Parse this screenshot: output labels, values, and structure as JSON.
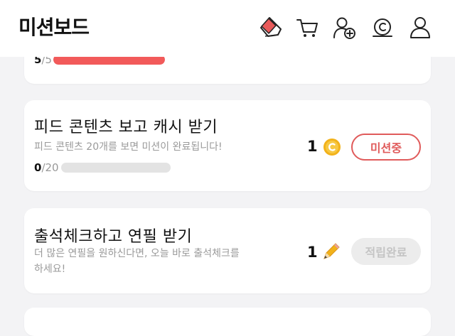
{
  "header": {
    "title": "미션보드"
  },
  "icons": {
    "ticket": "ticket-icon",
    "cart": "cart-icon",
    "add_friend": "add-friend-icon",
    "cash": "cash-coin-icon",
    "profile": "profile-icon"
  },
  "colors": {
    "accent": "#e05b5b",
    "progress_fill": "#f25a5a",
    "progress_track": "#e3e3e3",
    "coin": "#f2b21a",
    "button_done_bg": "#ececec"
  },
  "missions": [
    {
      "progress_current": "5",
      "progress_total": "/5",
      "progress_fraction": 1.0
    },
    {
      "title": "피드 콘텐츠 보고 캐시 받기",
      "description": "피드 콘텐츠 20개를 보면 미션이 완료됩니다!",
      "progress_current": "0",
      "progress_total": "/20",
      "progress_fraction": 0.0,
      "reward_count": "1",
      "reward_type": "cash-coin-icon",
      "button_label": "미션중",
      "button_state": "active"
    },
    {
      "title": "출석체크하고 연필 받기",
      "description": "더 많은 연필을 원하신다면, 오늘 바로 출석체크를\n하세요!",
      "reward_count": "1",
      "reward_type": "pencil-icon",
      "button_label": "적립완료",
      "button_state": "done"
    }
  ]
}
